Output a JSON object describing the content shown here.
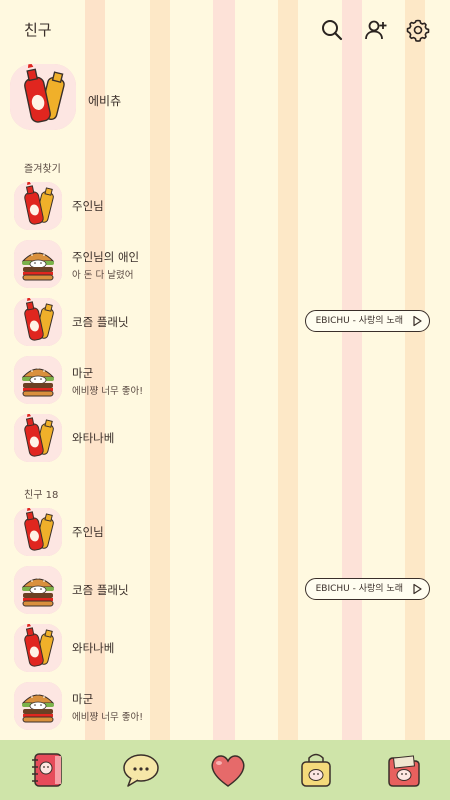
{
  "header": {
    "title": "친구"
  },
  "icons": {
    "search": "search-icon",
    "add_friend": "add-friend-icon",
    "settings": "gear-icon"
  },
  "me": {
    "name": "에비츄"
  },
  "favorites": {
    "label": "즐겨찾기",
    "items": [
      {
        "name": "주인님",
        "status": "",
        "avatar": "ketchup"
      },
      {
        "name": "주인님의 애인",
        "status": "아 돈 다 날렸어",
        "avatar": "burger"
      },
      {
        "name": "코즘 플래닛",
        "status": "",
        "avatar": "ketchup",
        "music": "EBICHU - 사랑의 노래"
      },
      {
        "name": "마군",
        "status": "에비쨩 너무 좋아!",
        "avatar": "burger"
      },
      {
        "name": "와타나베",
        "status": "",
        "avatar": "ketchup"
      }
    ]
  },
  "friends": {
    "label": "친구 18",
    "items": [
      {
        "name": "주인님",
        "status": "",
        "avatar": "ketchup"
      },
      {
        "name": "코즘 플래닛",
        "status": "",
        "avatar": "burger",
        "music": "EBICHU - 사랑의 노래"
      },
      {
        "name": "와타나베",
        "status": "",
        "avatar": "ketchup"
      },
      {
        "name": "마군",
        "status": "에비쨩 너무 좋아!",
        "avatar": "burger"
      }
    ]
  },
  "tabs": [
    {
      "name": "friends",
      "icon": "notebook-icon"
    },
    {
      "name": "chats",
      "icon": "speech-bubble-icon"
    },
    {
      "name": "view",
      "icon": "heart-icon"
    },
    {
      "name": "shopping",
      "icon": "shopping-bag-icon"
    },
    {
      "name": "more",
      "icon": "folder-icon"
    }
  ],
  "colors": {
    "background": "#fff9e0",
    "bottom_bar": "#cfe4a9",
    "avatar_bg": "#fde6e2",
    "ketchup": "#e0261f",
    "mustard": "#f0b02a"
  }
}
